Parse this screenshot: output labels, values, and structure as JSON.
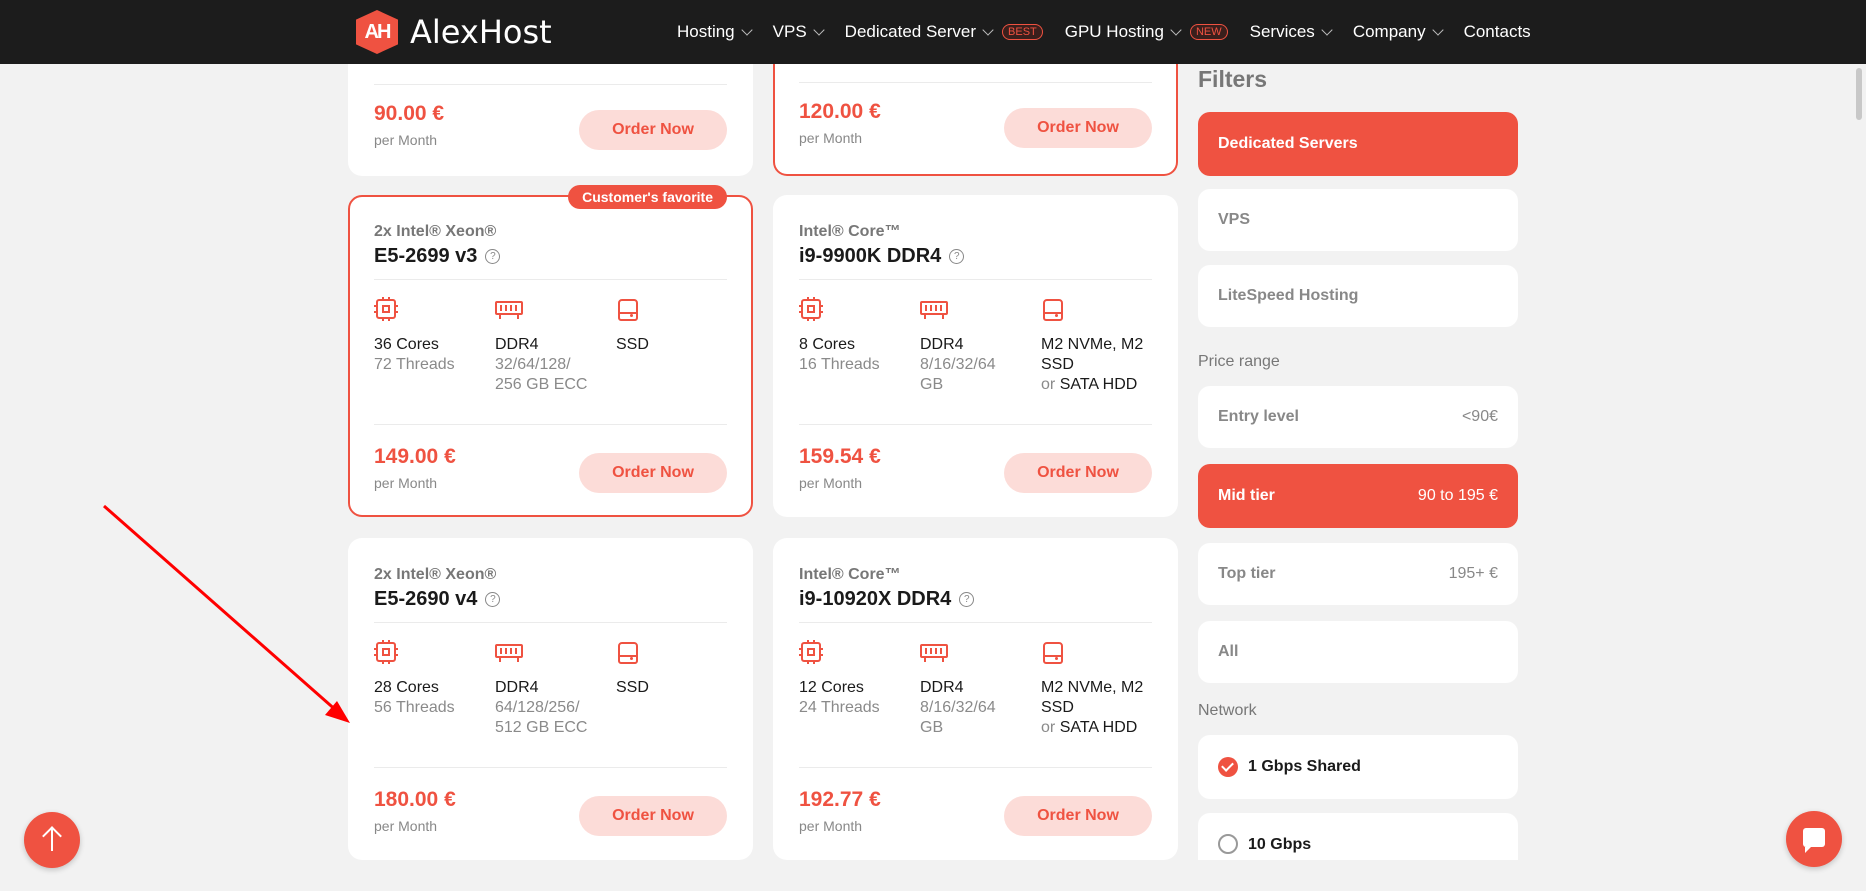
{
  "header": {
    "logo_mark": "AH",
    "logo_text": "AlexHost",
    "nav": [
      {
        "label": "Hosting",
        "dropdown": true,
        "badge": ""
      },
      {
        "label": "VPS",
        "dropdown": true,
        "badge": ""
      },
      {
        "label": "Dedicated Server",
        "dropdown": true,
        "badge": "BEST"
      },
      {
        "label": "GPU Hosting",
        "dropdown": true,
        "badge": "NEW"
      },
      {
        "label": "Services",
        "dropdown": true,
        "badge": ""
      },
      {
        "label": "Company",
        "dropdown": true,
        "badge": ""
      },
      {
        "label": "Contacts",
        "dropdown": false,
        "badge": ""
      }
    ]
  },
  "cards": [
    {
      "price": "90.00 €",
      "per": "per Month",
      "order": "Order Now"
    },
    {
      "price": "120.00 €",
      "per": "per Month",
      "order": "Order Now"
    },
    {
      "badge": "Customer's favorite",
      "family": "2x Intel® Xeon®",
      "model": "E5-2699 v3",
      "help": "?",
      "cores": "36 Cores",
      "threads": "72 Threads",
      "ram_type": "DDR4",
      "ram_size": "32/64/128/ 256 GB ECC",
      "disk": "SSD",
      "price": "149.00 €",
      "per": "per Month",
      "order": "Order Now"
    },
    {
      "family": "Intel® Core™",
      "model": "i9-9900K DDR4",
      "help": "?",
      "cores": "8 Cores",
      "threads": "16 Threads",
      "ram_type": "DDR4",
      "ram_size": "8/16/32/64 GB",
      "disk": "M2 NVMe, M2 SSD",
      "disk_or": "or",
      "disk_alt": "SATA HDD",
      "price": "159.54 €",
      "per": "per Month",
      "order": "Order Now"
    },
    {
      "family": "2x Intel® Xeon®",
      "model": "E5-2690 v4",
      "help": "?",
      "cores": "28 Cores",
      "threads": "56 Threads",
      "ram_type": "DDR4",
      "ram_size": "64/128/256/ 512 GB ECC",
      "disk": "SSD",
      "price": "180.00 €",
      "per": "per Month",
      "order": "Order Now"
    },
    {
      "family": "Intel® Core™",
      "model": "i9-10920X DDR4",
      "help": "?",
      "cores": "12 Cores",
      "threads": "24 Threads",
      "ram_type": "DDR4",
      "ram_size": "8/16/32/64 GB",
      "disk": "M2 NVMe, M2 SSD",
      "disk_or": "or",
      "disk_alt": "SATA HDD",
      "price": "192.77 €",
      "per": "per Month",
      "order": "Order Now"
    }
  ],
  "filters": {
    "title": "Filters",
    "types": [
      {
        "label": "Dedicated Servers",
        "active": true
      },
      {
        "label": "VPS",
        "active": false
      },
      {
        "label": "LiteSpeed Hosting",
        "active": false
      }
    ],
    "price_label": "Price range",
    "prices": [
      {
        "label": "Entry level",
        "range": "<90€",
        "active": false
      },
      {
        "label": "Mid tier",
        "range": "90 to 195 €",
        "active": true
      },
      {
        "label": "Top tier",
        "range": "195+ €",
        "active": false
      },
      {
        "label": "All",
        "range": "",
        "active": false
      }
    ],
    "network_label": "Network",
    "network": [
      {
        "label": "1 Gbps Shared",
        "checked": true
      },
      {
        "label": "10 Gbps",
        "checked": false
      }
    ]
  },
  "colors": {
    "accent": "#ef5241",
    "header_bg": "#1c1c1c",
    "button_bg": "#fcdcd8",
    "page_bg": "#f2f2f2",
    "annotation_arrow": "#ff0000"
  }
}
